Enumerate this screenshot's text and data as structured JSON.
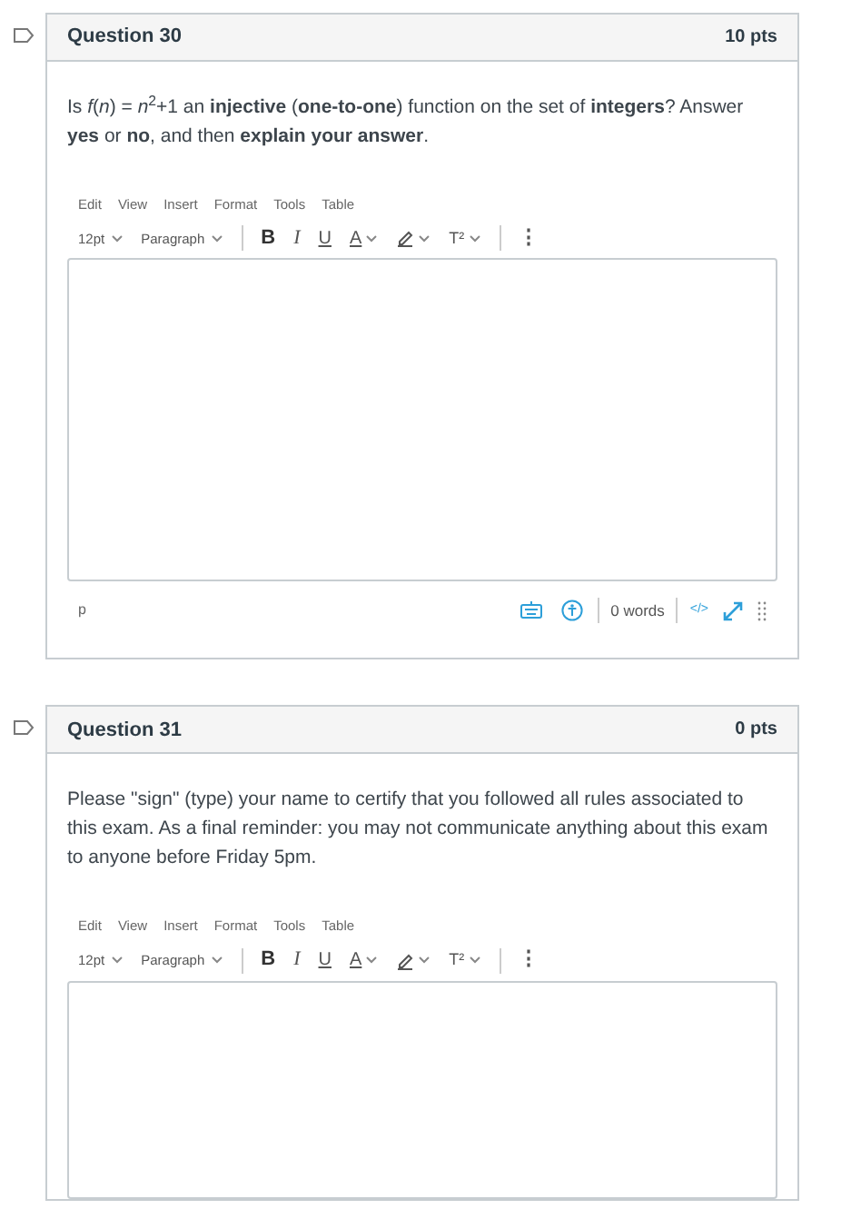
{
  "questions": [
    {
      "title": "Question 30",
      "points": "10 pts",
      "prompt": "Is *f*(*n*) = *n*$^{2}$+1 an **injective** (**one-to-one**) function on the set of **integers**? Answer **yes** or **no**, and then **explain your answer**.",
      "menu": [
        "Edit",
        "View",
        "Insert",
        "Format",
        "Tools",
        "Table"
      ],
      "font_size": "12pt",
      "block_format": "Paragraph",
      "toolbar": [
        {
          "kind": "bold",
          "label": "B"
        },
        {
          "kind": "italic",
          "label": "I"
        },
        {
          "kind": "underline",
          "label": "U"
        },
        {
          "kind": "color",
          "label": "A"
        },
        {
          "kind": "highlight"
        },
        {
          "kind": "superscript",
          "label": "T²"
        }
      ],
      "more": "⋮",
      "footer": {
        "path": "p",
        "words": "0 words",
        "html": "</>"
      }
    },
    {
      "title": "Question 31",
      "points": "0 pts",
      "prompt": "Please \"sign\" (type) your name to certify that you followed all rules associated to this exam. As a final reminder: you may not communicate anything about this exam to anyone before Friday 5pm.",
      "menu": [
        "Edit",
        "View",
        "Insert",
        "Format",
        "Tools",
        "Table"
      ],
      "font_size": "12pt",
      "block_format": "Paragraph",
      "toolbar": [
        {
          "kind": "bold",
          "label": "B"
        },
        {
          "kind": "italic",
          "label": "I"
        },
        {
          "kind": "underline",
          "label": "U"
        },
        {
          "kind": "color",
          "label": "A"
        },
        {
          "kind": "highlight"
        },
        {
          "kind": "superscript",
          "label": "T²"
        }
      ],
      "more": "⋮"
    }
  ]
}
